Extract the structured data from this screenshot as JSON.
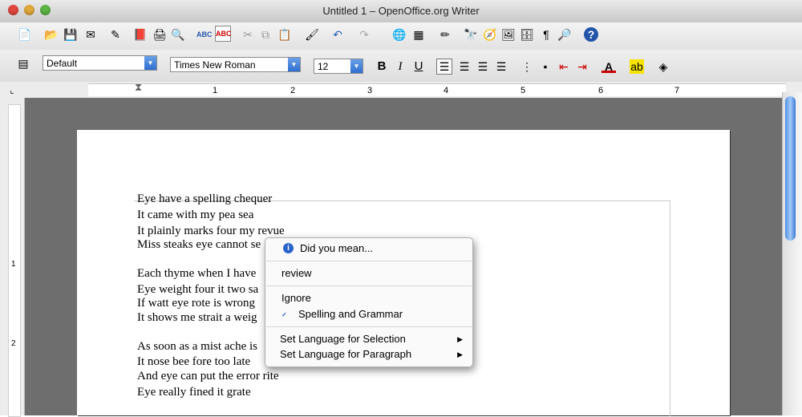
{
  "window": {
    "title": "Untitled 1 – OpenOffice.org Writer"
  },
  "format_toolbar": {
    "paragraph_style": "Default",
    "font_name": "Times New Roman",
    "font_size": "12",
    "bold": "B",
    "italic": "I",
    "underline": "U"
  },
  "ruler": {
    "numbers": [
      "1",
      "2",
      "3",
      "4",
      "5",
      "6",
      "7"
    ]
  },
  "vruler": {
    "numbers": [
      "1",
      "2"
    ]
  },
  "document": {
    "lines": [
      "Eye have a spelling chequer",
      "It came with my pea sea",
      "It plainly marks four my revue",
      "Miss steaks eye cannot se",
      "Each thyme when I have",
      "Eye weight four it two sa",
      "If watt eye rote is wrong",
      "It shows me strait a weig",
      "As soon as a mist ache is",
      "It nose bee fore too late",
      "And eye can put the error rite",
      "Eye really fined it grate"
    ]
  },
  "context_menu": {
    "did_you_mean": "Did you mean...",
    "suggestion": "review",
    "ignore": "Ignore",
    "spelling_grammar": "Spelling and Grammar",
    "set_lang_selection": "Set Language for Selection",
    "set_lang_paragraph": "Set Language for Paragraph"
  },
  "colors": {
    "accent": "#2f6fd0",
    "squiggle": "#d00000",
    "doc_bg": "#6e6e6e"
  }
}
